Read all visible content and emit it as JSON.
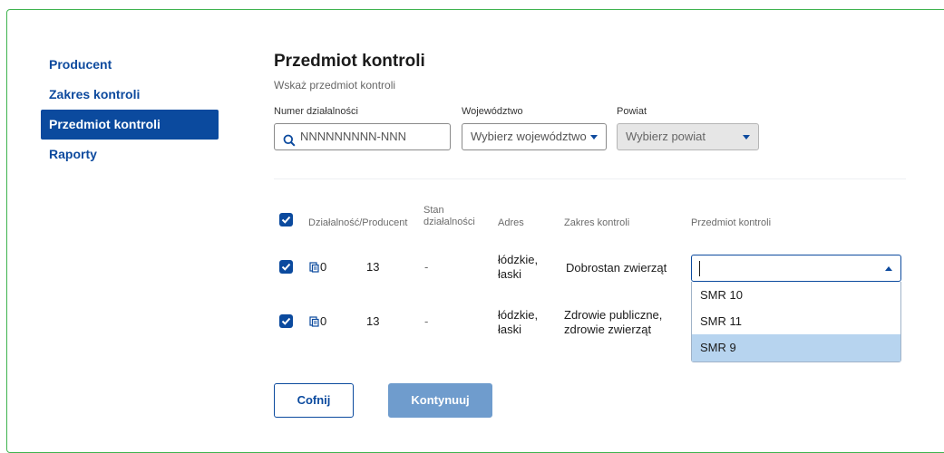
{
  "sidebar": {
    "items": [
      {
        "label": "Producent",
        "active": false
      },
      {
        "label": "Zakres kontroli",
        "active": false
      },
      {
        "label": "Przedmiot kontroli",
        "active": true
      },
      {
        "label": "Raporty",
        "active": false
      }
    ]
  },
  "header": {
    "title": "Przedmiot kontroli",
    "subtitle": "Wskaż przedmiot kontroli"
  },
  "filters": {
    "numer": {
      "label": "Numer działalności",
      "placeholder": "NNNNNNNNN-NNN",
      "icon": "search-icon"
    },
    "wojewodztwo": {
      "label": "Województwo",
      "value": "Wybierz województwo"
    },
    "powiat": {
      "label": "Powiat",
      "value": "Wybierz powiat",
      "disabled": true
    }
  },
  "table": {
    "columns": {
      "dzialalnosc": "Działalność",
      "producent": "/Producent",
      "stan_line1": "Stan",
      "stan_line2": "działalności",
      "adres": "Adres",
      "zakres": "Zakres kontroli",
      "przedmiot": "Przedmiot kontroli"
    },
    "rows": [
      {
        "checked": true,
        "dzialalnosc": "0",
        "producent": "13",
        "stan": "-",
        "adres_line1": "łódzkie,",
        "adres_line2": "łaski",
        "zakres_line1": "Dobrostan zwierząt",
        "zakres_line2": ""
      },
      {
        "checked": true,
        "dzialalnosc": "0",
        "producent": "13",
        "stan": "-",
        "adres_line1": "łódzkie,",
        "adres_line2": "łaski",
        "zakres_line1": "Zdrowie publiczne,",
        "zakres_line2": "zdrowie zwierząt"
      }
    ],
    "przedmiot_select": {
      "value": "",
      "open": true,
      "options": [
        "SMR 10",
        "SMR 11",
        "SMR 9"
      ],
      "highlighted": "SMR 9"
    }
  },
  "buttons": {
    "back": "Cofnij",
    "next": "Kontynuuj"
  },
  "colors": {
    "primary": "#0b4a9e",
    "frame_border": "#3fb34f",
    "next_button": "#6f9ccd",
    "option_highlight": "#b7d4ef"
  }
}
